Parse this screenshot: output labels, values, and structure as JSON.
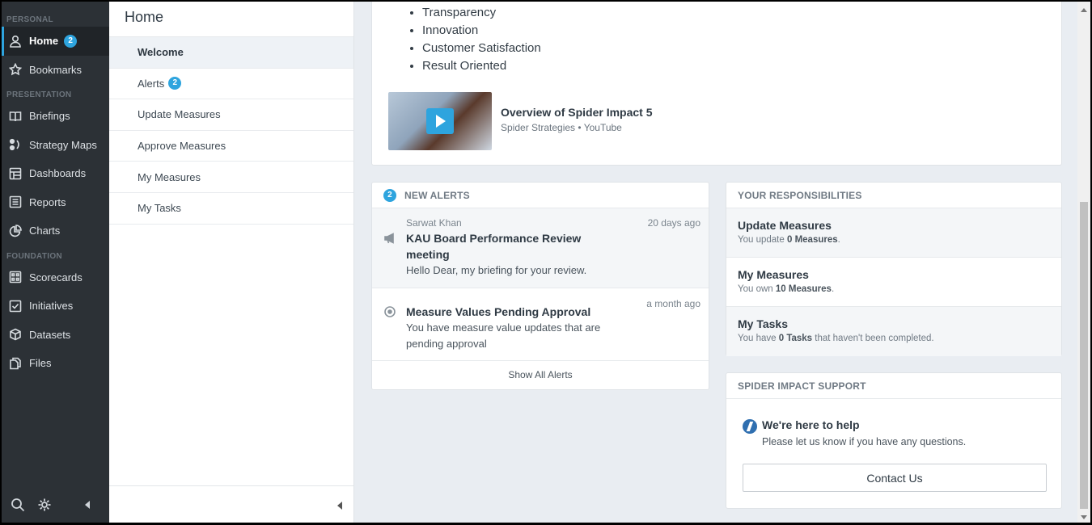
{
  "nav": {
    "sections": {
      "personal": "PERSONAL",
      "presentation": "PRESENTATION",
      "foundation": "FOUNDATION"
    },
    "home": {
      "label": "Home",
      "badge": "2",
      "icon": "user-icon"
    },
    "bookmarks": {
      "label": "Bookmarks",
      "icon": "star-icon"
    },
    "briefings": {
      "label": "Briefings",
      "icon": "book-icon"
    },
    "strategy_maps": {
      "label": "Strategy Maps",
      "icon": "strategy-map-icon"
    },
    "dashboards": {
      "label": "Dashboards",
      "icon": "dashboard-icon"
    },
    "reports": {
      "label": "Reports",
      "icon": "report-icon"
    },
    "charts": {
      "label": "Charts",
      "icon": "pie-chart-icon"
    },
    "scorecards": {
      "label": "Scorecards",
      "icon": "scorecard-icon"
    },
    "initiatives": {
      "label": "Initiatives",
      "icon": "checkbox-icon"
    },
    "datasets": {
      "label": "Datasets",
      "icon": "cube-icon"
    },
    "files": {
      "label": "Files",
      "icon": "files-icon"
    }
  },
  "subnav": {
    "title": "Home",
    "items": {
      "welcome": "Welcome",
      "alerts": "Alerts",
      "alerts_badge": "2",
      "update_measures": "Update Measures",
      "approve_measures": "Approve Measures",
      "my_measures": "My Measures",
      "my_tasks": "My Tasks"
    }
  },
  "welcome": {
    "values": [
      "Transparency",
      "Innovation",
      "Customer Satisfaction",
      "Result Oriented"
    ],
    "video": {
      "title": "Overview of Spider Impact 5",
      "source": "Spider Strategies • YouTube"
    }
  },
  "alerts": {
    "count": "2",
    "heading": "NEW ALERTS",
    "items": [
      {
        "author": "Sarwat Khan",
        "time": "20 days ago",
        "title": "KAU Board Performance Review meeting",
        "desc": "Hello Dear, my briefing for your review."
      },
      {
        "time": "a month ago",
        "title": "Measure Values Pending Approval",
        "desc": "You have measure value updates that are pending approval"
      }
    ],
    "show_all": "Show All Alerts"
  },
  "responsibilities": {
    "heading": "YOUR RESPONSIBILITIES",
    "items": [
      {
        "title": "Update Measures",
        "pre": "You update ",
        "bold": "0 Measures",
        "post": "."
      },
      {
        "title": "My Measures",
        "pre": "You own ",
        "bold": "10 Measures",
        "post": "."
      },
      {
        "title": "My Tasks",
        "pre": "You have ",
        "bold": "0 Tasks",
        "post": " that haven't been completed."
      }
    ]
  },
  "support": {
    "heading": "SPIDER IMPACT SUPPORT",
    "title": "We're here to help",
    "text": "Please let us know if you have any questions.",
    "button": "Contact Us"
  },
  "colors": {
    "accent": "#2ea4de",
    "nav_bg": "#2c3136"
  }
}
